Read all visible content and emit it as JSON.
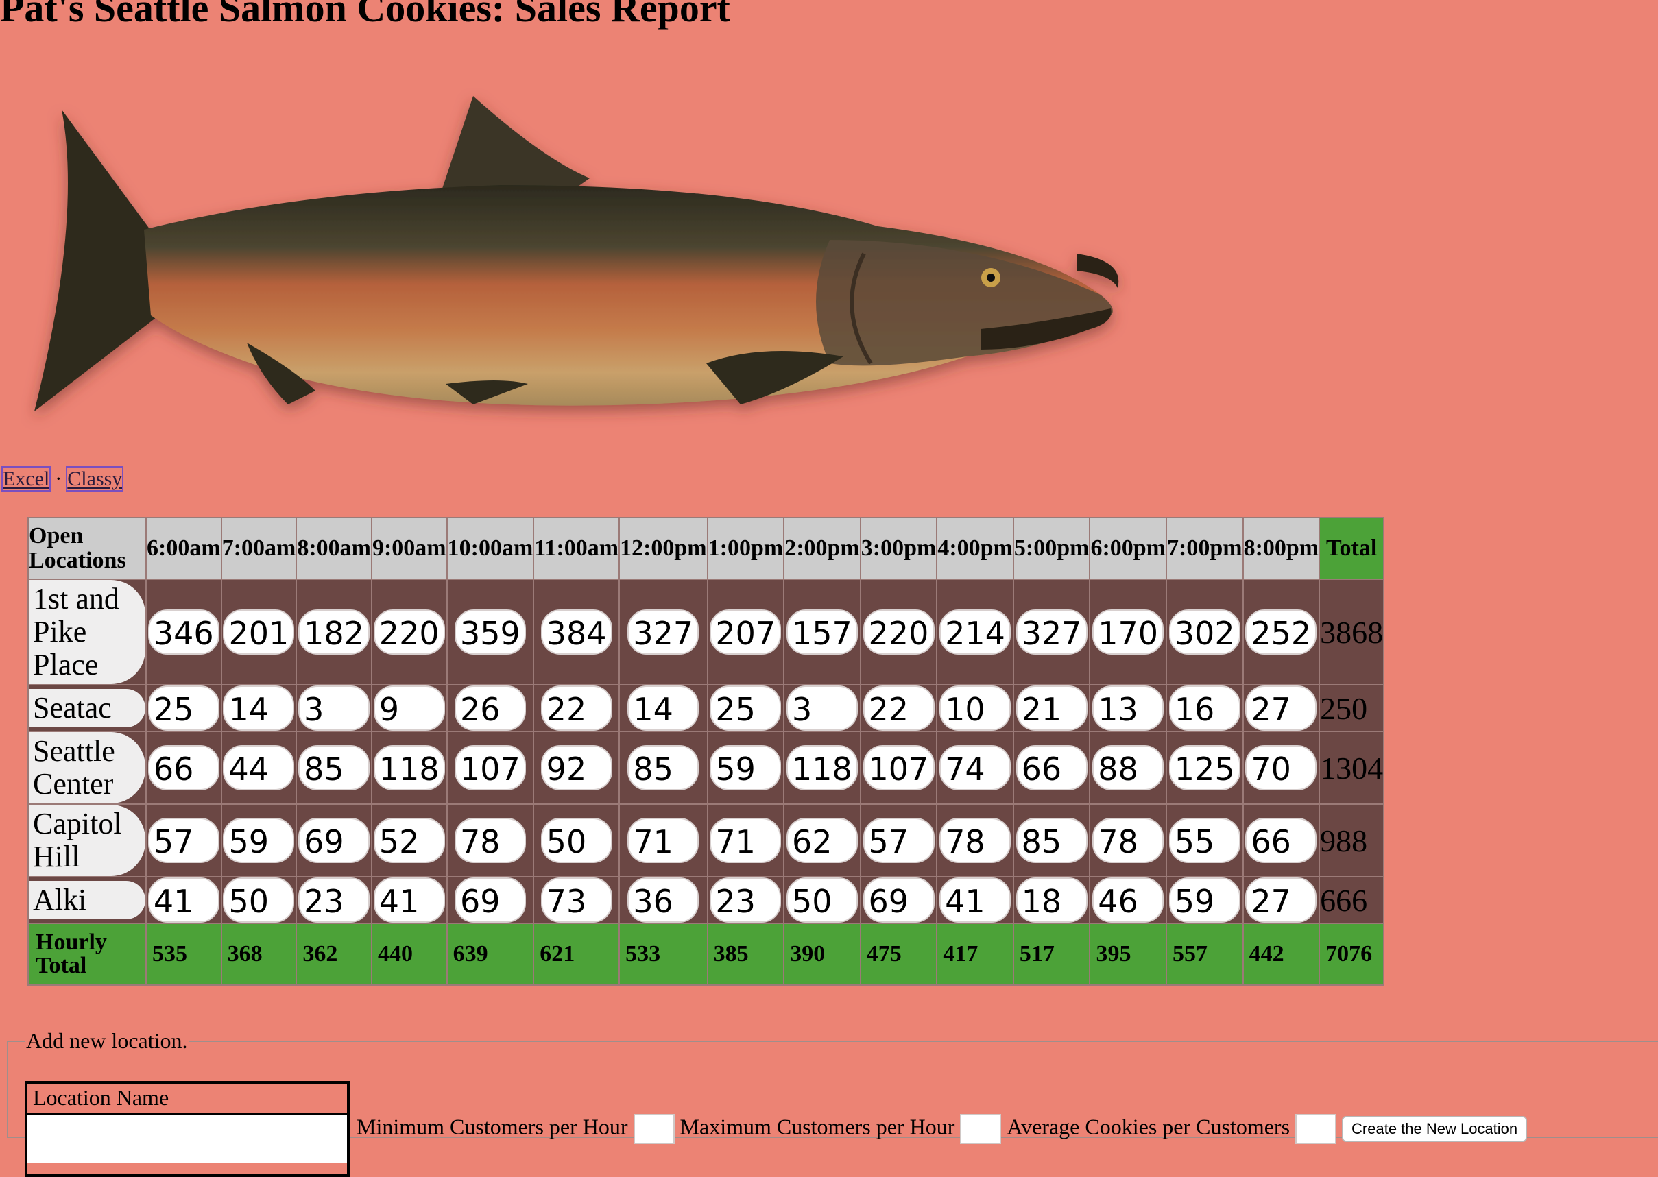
{
  "page": {
    "title": "Pat's Seattle Salmon Cookies: Sales Report"
  },
  "nav": {
    "links": [
      "Excel",
      "Classy"
    ],
    "separator": "·"
  },
  "table": {
    "corner_label": "Open Locations",
    "hours": [
      "6:00am",
      "7:00am",
      "8:00am",
      "9:00am",
      "10:00am",
      "11:00am",
      "12:00pm",
      "1:00pm",
      "2:00pm",
      "3:00pm",
      "4:00pm",
      "5:00pm",
      "6:00pm",
      "7:00pm",
      "8:00pm"
    ],
    "total_label": "Total",
    "rows": [
      {
        "location": "1st and Pike Place",
        "values": [
          346,
          201,
          182,
          220,
          359,
          384,
          327,
          207,
          157,
          220,
          214,
          327,
          170,
          302,
          252
        ],
        "total": 3868
      },
      {
        "location": "Seatac",
        "values": [
          25,
          14,
          3,
          9,
          26,
          22,
          14,
          25,
          3,
          22,
          10,
          21,
          13,
          16,
          27
        ],
        "total": 250
      },
      {
        "location": "Seattle Center",
        "values": [
          66,
          44,
          85,
          118,
          107,
          92,
          85,
          59,
          118,
          107,
          74,
          66,
          88,
          125,
          70
        ],
        "total": 1304
      },
      {
        "location": "Capitol Hill",
        "values": [
          57,
          59,
          69,
          52,
          78,
          50,
          71,
          71,
          62,
          57,
          78,
          85,
          78,
          55,
          66
        ],
        "total": 988
      },
      {
        "location": "Alki",
        "values": [
          41,
          50,
          23,
          41,
          69,
          73,
          36,
          23,
          50,
          69,
          41,
          18,
          46,
          59,
          27
        ],
        "total": 666
      }
    ],
    "footer_label": "Hourly Total",
    "hourly_totals": [
      535,
      368,
      362,
      440,
      639,
      621,
      533,
      385,
      390,
      475,
      417,
      517,
      395,
      557,
      442
    ],
    "grand_total": 7076
  },
  "form": {
    "legend": "Add new location.",
    "location_label": "Location Name",
    "min_label": "Minimum Customers per Hour",
    "max_label": "Maximum Customers per Hour",
    "avg_label": "Average Cookies per Customers",
    "submit_label": "Create the New Location"
  },
  "colors": {
    "background": "#ec8374",
    "header": "#cccccc",
    "row": "#6b4744",
    "total": "#4ca238"
  }
}
